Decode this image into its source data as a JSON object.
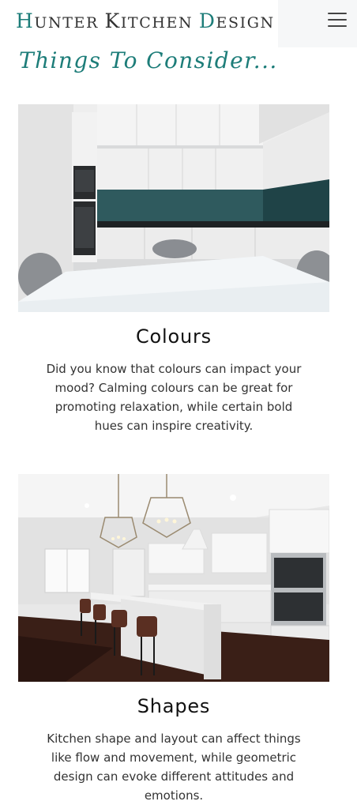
{
  "header": {
    "brand_parts": [
      "H",
      "UNTER ",
      "K",
      "ITCHEN ",
      "D",
      "ESIGN"
    ],
    "menu_icon": "hamburger-menu-icon"
  },
  "section": {
    "title": "Things To Consider..."
  },
  "cards": [
    {
      "heading": "Colours",
      "text": "Did you know that colours can impact your mood? Calming colours can be great for promoting relaxation, while certain bold hues can inspire creativity."
    },
    {
      "heading": "Shapes",
      "text": "Kitchen shape and layout can affect things like flow and movement, while geometric design can evoke different attitudes and emotions."
    }
  ],
  "colors": {
    "accent": "#1d7d79",
    "menu_bg": "#f6f7f8",
    "text": "#333333"
  }
}
